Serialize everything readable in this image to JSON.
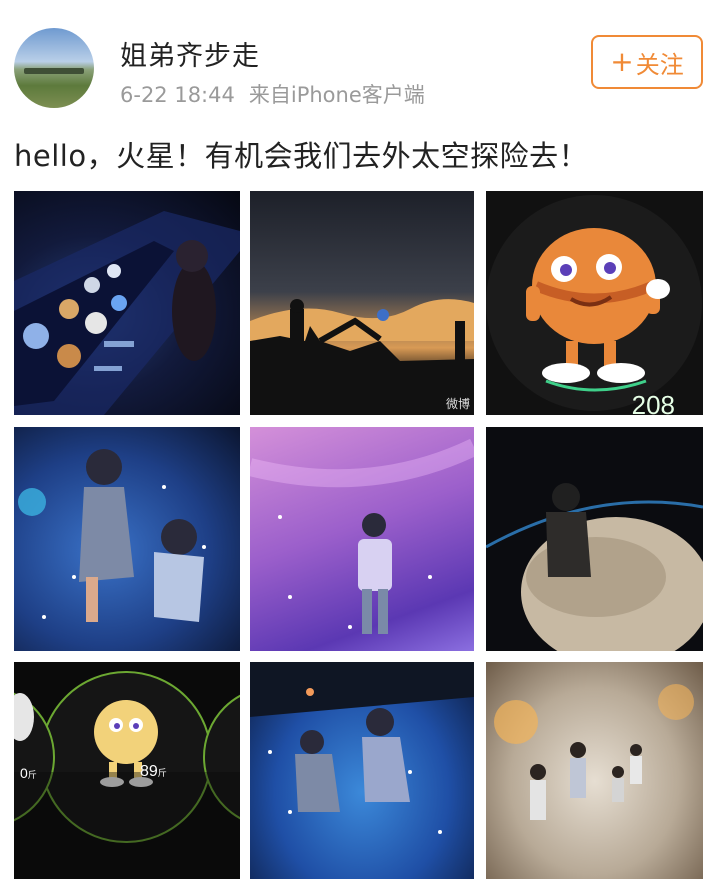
{
  "post": {
    "username": "姐弟齐步走",
    "time": "6-22 18:44",
    "source": "来自iPhone客户端",
    "follow_label": "关注",
    "follow_plus": "+",
    "text": "hello，火星！有机会我们去外太空探险去！"
  },
  "photos": [
    {
      "name": "planet-touch-table",
      "overlay_text": ""
    },
    {
      "name": "mars-landscape-silhouette",
      "overlay_text": "微博"
    },
    {
      "name": "mars-mascot",
      "overlay_text": "208"
    },
    {
      "name": "kids-blue-floor",
      "overlay_text": ""
    },
    {
      "name": "child-purple-galaxy",
      "overlay_text": ""
    },
    {
      "name": "child-mars-globe",
      "overlay_text": ""
    },
    {
      "name": "mascot-weight-display",
      "overlay_text": "89",
      "overlay_unit": "斤",
      "overlay_left": "0",
      "overlay_left_unit": "斤"
    },
    {
      "name": "kids-star-floor",
      "overlay_text": ""
    },
    {
      "name": "kids-bright-galaxy",
      "overlay_text": ""
    }
  ],
  "colors": {
    "follow_accent": "#f08a36",
    "meta_gray": "#9a9a9a"
  },
  "icons": [
    "plus-icon"
  ]
}
